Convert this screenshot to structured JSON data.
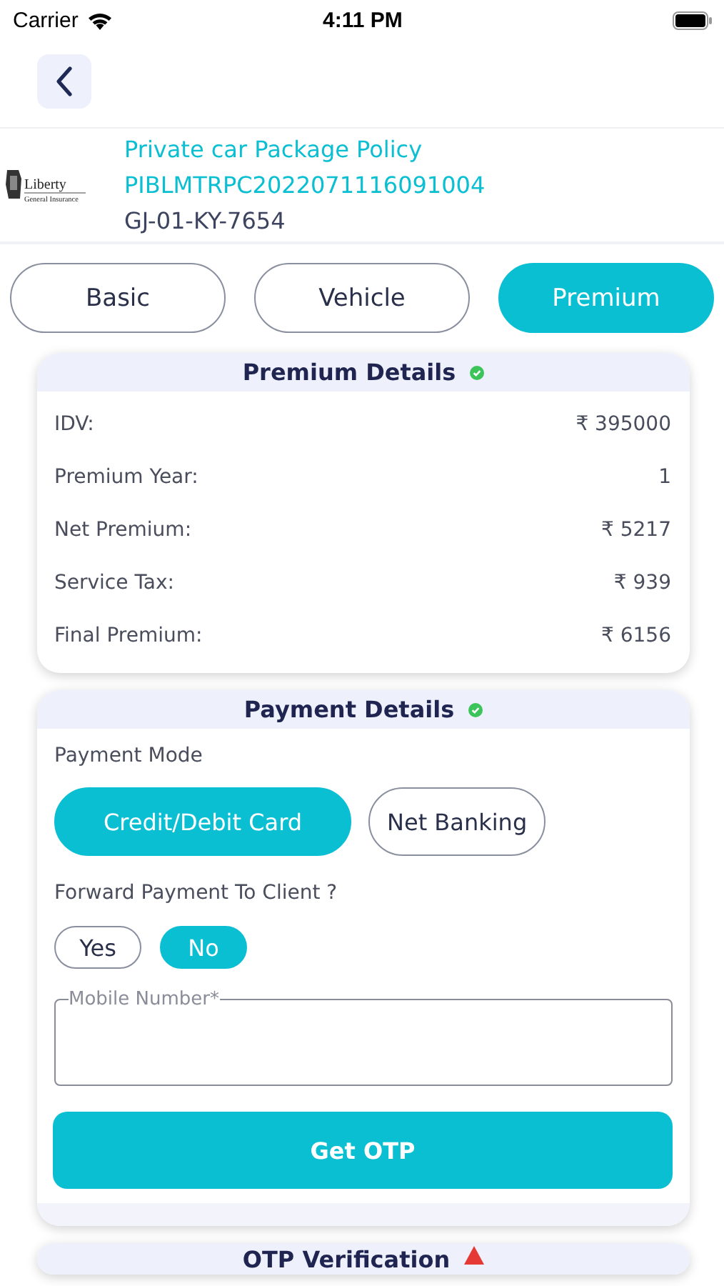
{
  "status_bar": {
    "carrier": "Carrier",
    "time": "4:11 PM"
  },
  "policy": {
    "logo_name": "Liberty",
    "logo_subtitle": "General Insurance",
    "title": "Private car Package Policy",
    "number": "PIBLMTRPC2022071116091004",
    "registration": "GJ-01-KY-7654"
  },
  "tabs": [
    {
      "label": "Basic",
      "selected": false
    },
    {
      "label": "Vehicle",
      "selected": false
    },
    {
      "label": "Premium",
      "selected": true
    }
  ],
  "premium_details": {
    "title": "Premium Details",
    "complete": true,
    "rows": [
      {
        "label": "IDV:",
        "value": "₹ 395000"
      },
      {
        "label": "Premium Year:",
        "value": "1"
      },
      {
        "label": "Net Premium:",
        "value": "₹ 5217"
      },
      {
        "label": "Service Tax:",
        "value": "₹ 939"
      },
      {
        "label": "Final Premium:",
        "value": "₹ 6156"
      }
    ]
  },
  "payment_details": {
    "title": "Payment Details",
    "complete": true,
    "mode_label": "Payment Mode",
    "modes": [
      {
        "label": "Credit/Debit Card",
        "selected": true
      },
      {
        "label": "Net Banking",
        "selected": false
      }
    ],
    "forward_label": "Forward Payment To Client ?",
    "forward_options": [
      {
        "label": "Yes",
        "selected": false
      },
      {
        "label": "No",
        "selected": true
      }
    ],
    "mobile_field": {
      "label": "Mobile Number*"
    },
    "button": "Get OTP"
  },
  "otp_verification": {
    "title": "OTP Verification",
    "complete": false
  }
}
